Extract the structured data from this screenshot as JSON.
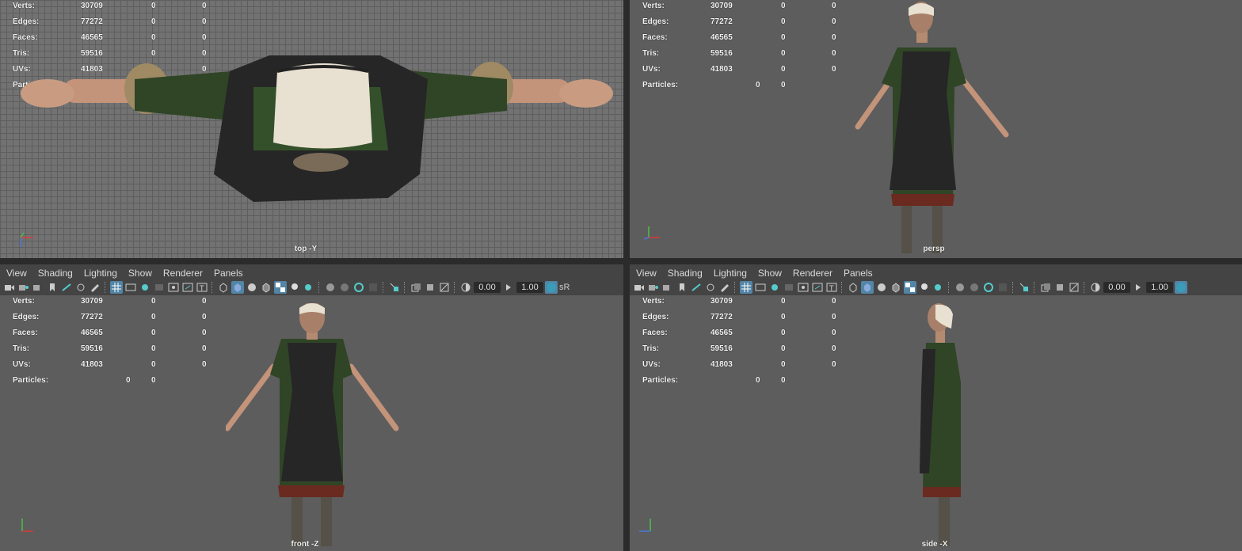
{
  "menu": [
    "View",
    "Shading",
    "Lighting",
    "Show",
    "Renderer",
    "Panels"
  ],
  "toolbar": {
    "field_a": "0.00",
    "field_b": "1.00",
    "srgb": "sR"
  },
  "hud": {
    "verts_label": "Verts:",
    "edges_label": "Edges:",
    "faces_label": "Faces:",
    "tris_label": "Tris:",
    "uvs_label": "UVs:",
    "particles_label": "Particles:",
    "verts": "30709",
    "edges": "77272",
    "faces": "46565",
    "tris": "59516",
    "uvs": "41803",
    "zero": "0"
  },
  "views": {
    "top": "top -Y",
    "persp": "persp",
    "front": "front -Z",
    "side": "side -X"
  },
  "colors": {
    "viewport_bg": "#5d5d5d",
    "grid_bg": "#727272",
    "panel_bg": "#444444",
    "accent": "#5285a6",
    "dress_green": "#2f4526",
    "apron_black": "#262626",
    "skin": "#c89a80",
    "bonnet": "#e8e0d0"
  },
  "icons": [
    "camera-icon",
    "bookmark-icon",
    "grid-icon",
    "film-gate-icon",
    "wireframe-cube-icon",
    "smooth-shade-icon",
    "light-icon",
    "isolate-icon",
    "exposure-icon",
    "gamma-icon",
    "color-manage-icon"
  ]
}
